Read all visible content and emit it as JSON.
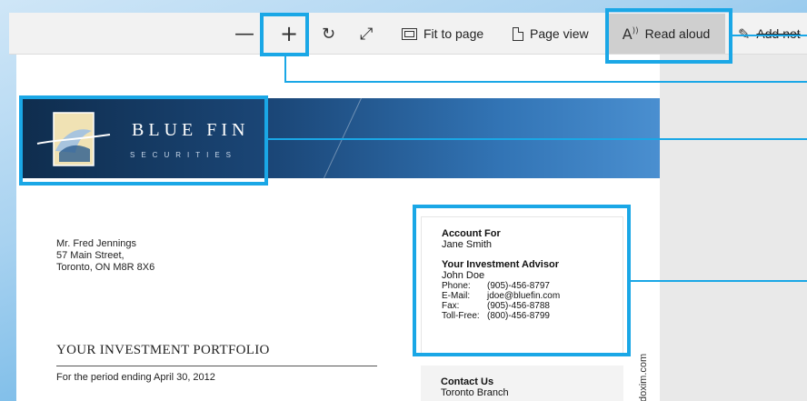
{
  "toolbar": {
    "zoom_out_icon": "minus-icon",
    "zoom_in_icon": "plus-icon",
    "rotate_icon": "rotate-icon",
    "fullscreen_icon": "expand-icon",
    "fit_to_page": "Fit to page",
    "page_view": "Page view",
    "read_aloud": "Read aloud",
    "add_notes": "Add not",
    "read_aloud_glyph": "A⁾"
  },
  "banner": {
    "brand": "BLUE FIN",
    "brand_sub": "SECURITIES"
  },
  "recipient": {
    "name": "Mr. Fred Jennings",
    "street": "57 Main Street,",
    "city": "Toronto, ON M8R 8X6"
  },
  "portfolio": {
    "heading": "YOUR INVESTMENT PORTFOLIO",
    "period": "For the period ending April 30, 2012"
  },
  "account": {
    "account_for_label": "Account For",
    "account_for": "Jane Smith",
    "advisor_label": "Your Investment Advisor",
    "advisor": "John Doe",
    "contacts": [
      {
        "k": "Phone:",
        "v": "(905)-456-8797"
      },
      {
        "k": "E-Mail:",
        "v": "jdoe@bluefin.com"
      },
      {
        "k": "Fax:",
        "v": "(905)-456-8788"
      },
      {
        "k": "Toll-Free:",
        "v": "(800)-456-8799"
      }
    ]
  },
  "contact_us": {
    "label": "Contact Us",
    "branch": "Toronto Branch"
  },
  "side_url": "doxim.com",
  "colors": {
    "highlight": "#1aa7e6",
    "banner_dark": "#0f2d4e",
    "banner_light": "#4a8fd0"
  }
}
